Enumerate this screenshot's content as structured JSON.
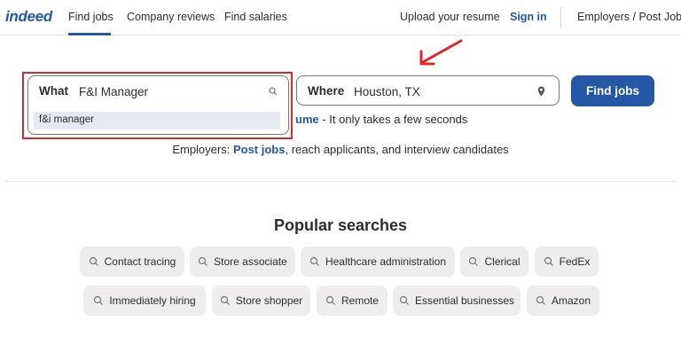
{
  "header": {
    "logo": "indeed",
    "nav": [
      "Find jobs",
      "Company reviews",
      "Find salaries"
    ],
    "upload_resume": "Upload your resume",
    "sign_in": "Sign in",
    "employers": "Employers / Post Job"
  },
  "search": {
    "what_label": "What",
    "what_value": "F&I Manager",
    "suggestion": "f&i manager",
    "where_label": "Where",
    "where_value": "Houston, TX",
    "find_button": "Find jobs"
  },
  "resume_line": {
    "link": "ume",
    "text": " - It only takes a few seconds"
  },
  "employers_line": {
    "prefix": "Employers: ",
    "link": "Post jobs",
    "suffix": ", reach applicants, and interview candidates"
  },
  "popular": {
    "title": "Popular searches",
    "row1": [
      "Contact tracing",
      "Store associate",
      "Healthcare administration",
      "Clerical",
      "FedEx"
    ],
    "row2": [
      "Immediately hiring",
      "Store shopper",
      "Remote",
      "Essential businesses",
      "Amazon"
    ]
  },
  "colors": {
    "brand": "#2557a7",
    "annotation": "#d92b2b",
    "pill_bg": "#eeedec"
  }
}
